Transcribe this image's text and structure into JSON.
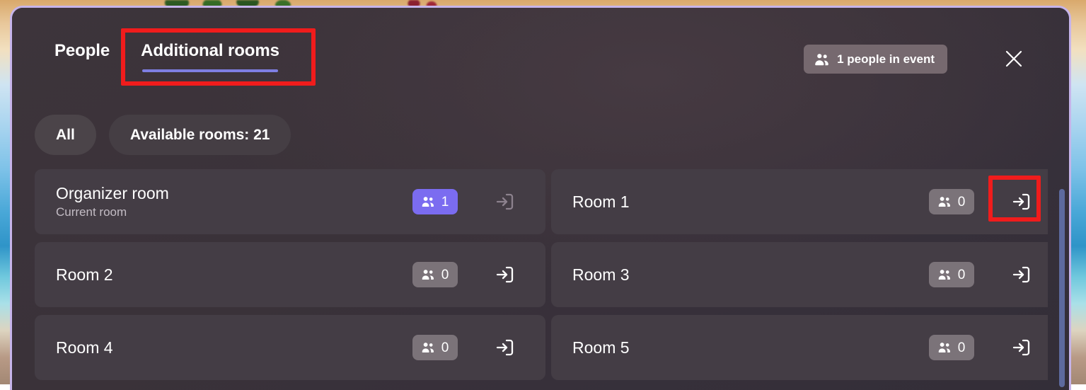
{
  "window": {
    "border_color": "#c6b4ea",
    "panel_background": "#3a3239"
  },
  "header": {
    "tabs": [
      {
        "id": "people",
        "label": "People",
        "selected": false
      },
      {
        "id": "additional-rooms",
        "label": "Additional rooms",
        "selected": true
      }
    ],
    "active_tab_underline_color": "#7e7fe3",
    "people_in_event": {
      "icon": "people-icon",
      "label": "1 people in event",
      "count": 1
    },
    "close_button": {
      "icon": "close-icon",
      "label": "Close"
    }
  },
  "filters": {
    "chips": [
      {
        "id": "all",
        "label": "All",
        "selected": true
      },
      {
        "id": "available-rooms",
        "label": "Available rooms: 21",
        "selected": false
      }
    ],
    "available_rooms_count": 21
  },
  "rooms": [
    {
      "name": "Organizer room",
      "subtitle": "Current room",
      "participants": 1,
      "badge_style": "accent",
      "badge_color": "#7b6cf0",
      "join_enabled": false,
      "join_icon": "sign-in-icon"
    },
    {
      "name": "Room 1",
      "subtitle": "",
      "participants": 0,
      "badge_style": "default",
      "badge_color": "#7b7379",
      "join_enabled": true,
      "join_icon": "sign-in-icon"
    },
    {
      "name": "Room 2",
      "subtitle": "",
      "participants": 0,
      "badge_style": "default",
      "badge_color": "#7b7379",
      "join_enabled": true,
      "join_icon": "sign-in-icon"
    },
    {
      "name": "Room 3",
      "subtitle": "",
      "participants": 0,
      "badge_style": "default",
      "badge_color": "#7b7379",
      "join_enabled": true,
      "join_icon": "sign-in-icon"
    },
    {
      "name": "Room 4",
      "subtitle": "",
      "participants": 0,
      "badge_style": "default",
      "badge_color": "#7b7379",
      "join_enabled": true,
      "join_icon": "sign-in-icon"
    },
    {
      "name": "Room 5",
      "subtitle": "",
      "participants": 0,
      "badge_style": "default",
      "badge_color": "#7b7379",
      "join_enabled": true,
      "join_icon": "sign-in-icon"
    }
  ],
  "annotations": [
    {
      "id": "annotation-tab",
      "target": "additional-rooms-tab",
      "color": "#f01c1c"
    },
    {
      "id": "annotation-join",
      "target": "room-1-join-button",
      "color": "#f01c1c"
    }
  ],
  "scrollbar": {
    "orientation": "vertical",
    "thumb_color": "#5d6a9e"
  }
}
